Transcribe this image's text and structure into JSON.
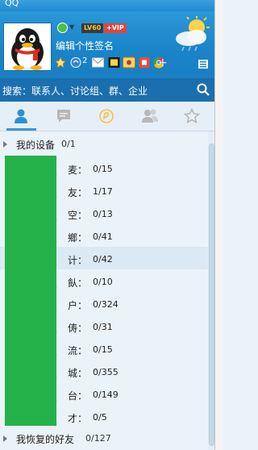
{
  "app": {
    "title": "QQ"
  },
  "profile": {
    "level": "LV60",
    "vip": "+VIP",
    "signature": "编辑个性签名",
    "toolbar_count": "2"
  },
  "search": {
    "placeholder": "搜索：联系人、讨论组、群、企业"
  },
  "tabs": [
    {
      "icon": "contacts-icon",
      "active": true
    },
    {
      "icon": "chat-icon"
    },
    {
      "icon": "qzone-icon"
    },
    {
      "icon": "groups-icon"
    },
    {
      "icon": "favorites-icon"
    }
  ],
  "groups": {
    "devices": {
      "label": "我的设备",
      "count": "0/1"
    },
    "items": [
      {
        "label": "麦：",
        "count": "0/15"
      },
      {
        "label": "友：",
        "count": "1/17"
      },
      {
        "label": "空：",
        "count": "0/13"
      },
      {
        "label": "鄉：",
        "count": "0/41"
      },
      {
        "label": "计：",
        "count": "0/42"
      },
      {
        "label": "飤：",
        "count": "0/10"
      },
      {
        "label": "户：",
        "count": "0/324"
      },
      {
        "label": "俦：",
        "count": "0/31"
      },
      {
        "label": "流：",
        "count": "0/15"
      },
      {
        "label": "城：",
        "count": "0/355"
      },
      {
        "label": "台：",
        "count": "0/149"
      },
      {
        "label": "才：",
        "count": "0/5"
      }
    ],
    "recovered": {
      "label": "我恢复的好友",
      "count": "0/127"
    }
  },
  "colors": {
    "profile_bg": "#1f8ad0",
    "search_bg": "#1b6fae",
    "list_bg": "#eaf3fa",
    "redaction": "#25b14a"
  }
}
